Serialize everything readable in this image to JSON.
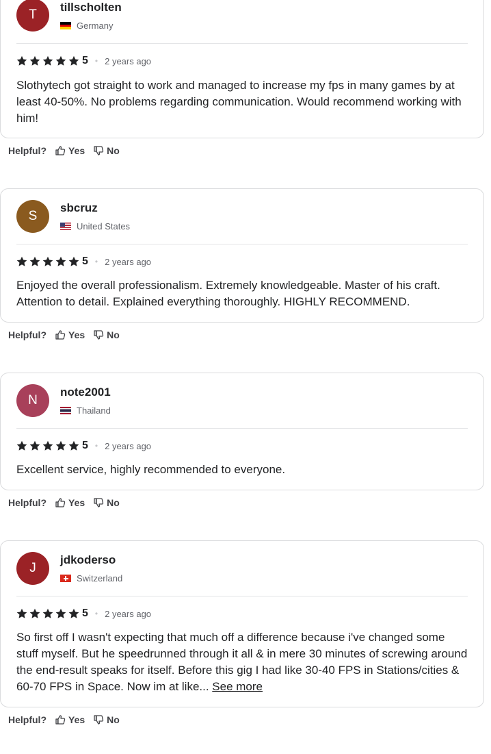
{
  "helpful_label": "Helpful?",
  "yes_label": "Yes",
  "no_label": "No",
  "see_more_label": "See more",
  "reviews": [
    {
      "initial": "T",
      "avatar_color": "#9b2226",
      "username": "tillscholten",
      "country": "Germany",
      "flag": "germany-flag",
      "stars": 5,
      "score": "5",
      "time": "2 years ago",
      "text": "Slothytech got straight to work and managed to increase my fps in many games by at least 40-50%. No problems regarding communication. Would recommend working with him!"
    },
    {
      "initial": "S",
      "avatar_color": "#8a5a1f",
      "username": "sbcruz",
      "country": "United States",
      "flag": "united-states-flag",
      "stars": 5,
      "score": "5",
      "time": "2 years ago",
      "text": "Enjoyed the overall professionalism. Extremely knowledgeable. Master of his craft. Attention to detail. Explained everything thoroughly. HIGHLY RECOMMEND."
    },
    {
      "initial": "N",
      "avatar_color": "#a8405a",
      "username": "note2001",
      "country": "Thailand",
      "flag": "thailand-flag",
      "stars": 5,
      "score": "5",
      "time": "2 years ago",
      "text": "Excellent service, highly recommended to everyone."
    },
    {
      "initial": "J",
      "avatar_color": "#9b2226",
      "username": "jdkoderso",
      "country": "Switzerland",
      "flag": "switzerland-flag",
      "stars": 5,
      "score": "5",
      "time": "2 years ago",
      "text": "So first off I wasn't expecting that much off a difference because i've changed some stuff myself. But he speedrunned through it all & in mere 30 minutes of screwing around the end-result speaks for itself. Before this gig I had like 30-40 FPS in Stations/cities & 60-70 FPS in Space. Now im at like..."
    }
  ]
}
